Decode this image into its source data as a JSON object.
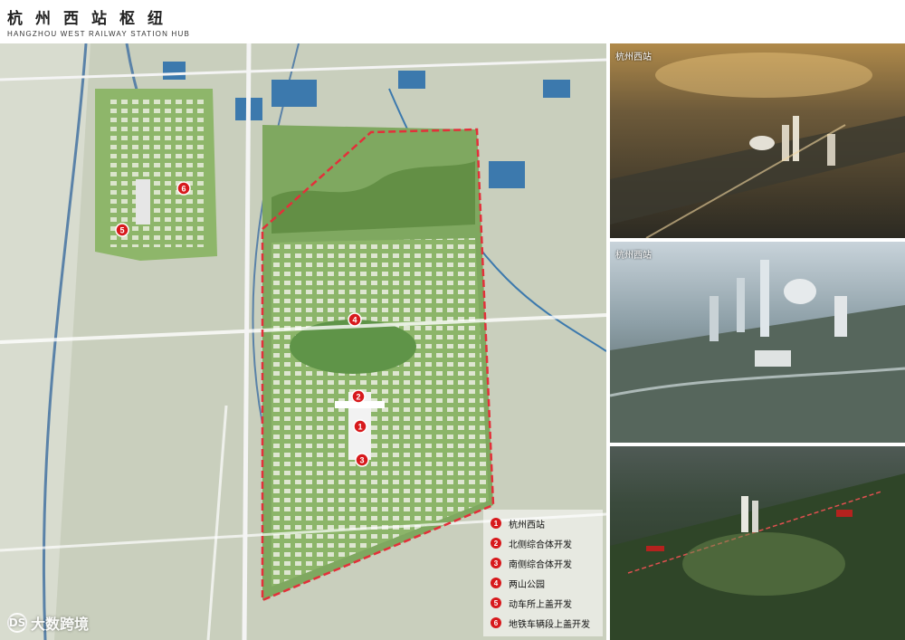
{
  "title": {
    "cn": "杭州西站枢纽",
    "en": "HANGZHOU WEST RAILWAY STATION HUB"
  },
  "map": {
    "markers": [
      {
        "num": "1"
      },
      {
        "num": "2"
      },
      {
        "num": "3"
      },
      {
        "num": "4"
      },
      {
        "num": "5"
      },
      {
        "num": "6"
      }
    ]
  },
  "legend": {
    "items": [
      {
        "num": "1",
        "label": "杭州西站"
      },
      {
        "num": "2",
        "label": "北侧综合体开发"
      },
      {
        "num": "3",
        "label": "南侧综合体开发"
      },
      {
        "num": "4",
        "label": "两山公园"
      },
      {
        "num": "5",
        "label": "动车所上盖开发"
      },
      {
        "num": "6",
        "label": "地铁车辆段上盖开发"
      }
    ]
  },
  "panels": [
    {
      "label": "杭州西站"
    },
    {
      "label": "杭州西站"
    },
    {
      "label": ""
    }
  ],
  "watermark": {
    "logo": "DS",
    "text": "大数跨境"
  },
  "colors": {
    "marker": "#d7191c",
    "boundary": "#e3303a",
    "water": "#3c79ad",
    "green": "#7fa860"
  }
}
